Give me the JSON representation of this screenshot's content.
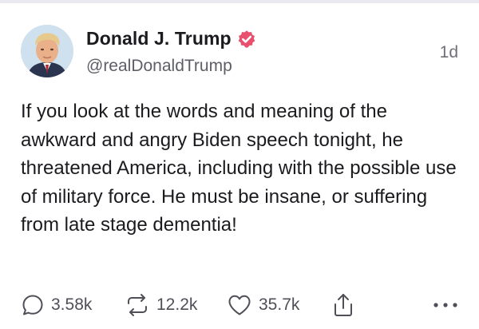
{
  "post": {
    "author_name": "Donald J. Trump",
    "author_handle": "@realDonaldTrump",
    "verified": true,
    "timestamp": "1d",
    "text": "If you look at the words and meaning of the awkward and angry Biden speech tonight, he threatened America, including with the possible use of military force. He must be insane, or suffering from late stage dementia!",
    "avatar_icon": "profile-photo",
    "verified_icon": "verified-badge-icon",
    "verified_color": "#e8506e"
  },
  "actions": {
    "reply": {
      "icon": "reply-icon",
      "count": "3.58k"
    },
    "retruth": {
      "icon": "retruth-icon",
      "count": "12.2k"
    },
    "like": {
      "icon": "heart-icon",
      "count": "35.7k"
    },
    "share": {
      "icon": "share-icon"
    },
    "more": {
      "icon": "more-icon"
    }
  },
  "colors": {
    "text": "#1b1b1f",
    "muted": "#5e5e66",
    "divider": "#e9e9ef",
    "icon": "#4f4f57"
  }
}
